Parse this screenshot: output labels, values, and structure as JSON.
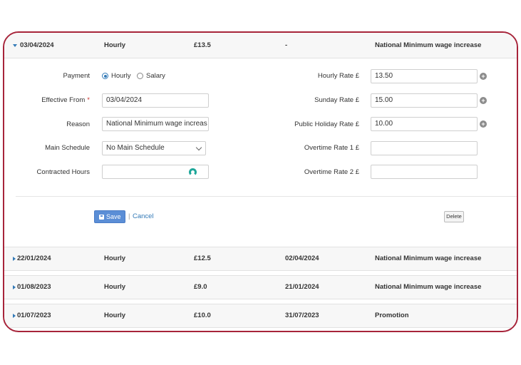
{
  "columns_note": "",
  "active_record": {
    "effective_date": "03/04/2024",
    "pay_type": "Hourly",
    "rate": "£13.5",
    "end_date": "-",
    "reason": "National Minimum wage increase"
  },
  "form": {
    "payment_label": "Payment",
    "payment_options": [
      "Hourly",
      "Salary"
    ],
    "payment_selected": "Hourly",
    "effective_from_label": "Effective From",
    "required_marker": "*",
    "effective_from_value": "03/04/2024",
    "reason_label": "Reason",
    "reason_value": "National Minimum wage increas",
    "main_schedule_label": "Main Schedule",
    "main_schedule_value": "No Main Schedule",
    "contracted_hours_label": "Contracted Hours",
    "contracted_hours_value": "",
    "hourly_rate_label": "Hourly Rate £",
    "hourly_rate_value": "13.50",
    "sunday_rate_label": "Sunday Rate £",
    "sunday_rate_value": "15.00",
    "public_holiday_rate_label": "Public Holiday Rate £",
    "public_holiday_rate_value": "10.00",
    "overtime_rate_1_label": "Overtime Rate 1 £",
    "overtime_rate_1_value": "",
    "overtime_rate_2_label": "Overtime Rate 2 £",
    "overtime_rate_2_value": "",
    "plus_glyph": "+",
    "save_label": "Save",
    "separator": "|",
    "cancel_label": "Cancel",
    "delete_label": "Delete"
  },
  "history": [
    {
      "effective_date": "22/01/2024",
      "pay_type": "Hourly",
      "rate": "£12.5",
      "end_date": "02/04/2024",
      "reason": "National Minimum wage increase"
    },
    {
      "effective_date": "01/08/2023",
      "pay_type": "Hourly",
      "rate": "£9.0",
      "end_date": "21/01/2024",
      "reason": "National Minimum wage increase"
    },
    {
      "effective_date": "01/07/2023",
      "pay_type": "Hourly",
      "rate": "£10.0",
      "end_date": "31/07/2023",
      "reason": "Promotion"
    }
  ],
  "colors": {
    "frame_border": "#a7243a",
    "accent": "#337ab7",
    "save_button": "#5b8ed6",
    "spinner": "#1fa79a"
  }
}
